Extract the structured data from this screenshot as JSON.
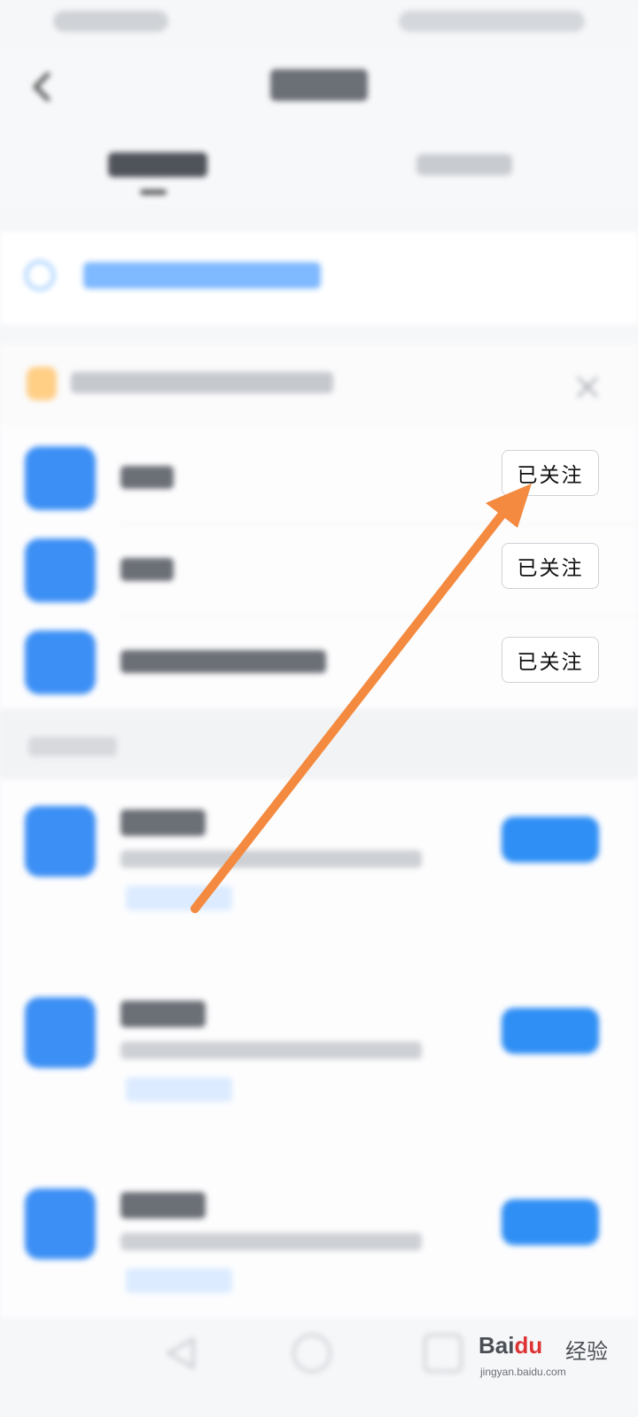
{
  "followed_contacts": {
    "items": [
      {
        "button_label": "已关注"
      },
      {
        "button_label": "已关注"
      },
      {
        "button_label": "已关注"
      }
    ]
  },
  "watermark": {
    "brand_a": "Bai",
    "brand_b": "du",
    "brand_cn": "经验",
    "url": "jingyan.baidu.com"
  },
  "colors": {
    "accent": "#2f8ff5",
    "avatar": "#3c8ff5",
    "arrow": "#f38a3f"
  },
  "icons": {
    "back": "chevron-left-icon",
    "add": "add-contact-icon",
    "tip": "bulb-icon",
    "close": "close-icon"
  }
}
